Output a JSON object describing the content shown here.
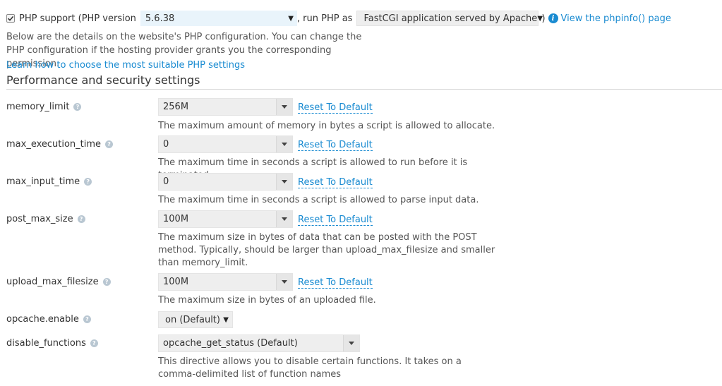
{
  "php_support": {
    "checked": true,
    "label": "PHP support (PHP version",
    "version_value": "5.6.38",
    "run_as_label": ", run PHP as",
    "handler_value": "FastCGI application served by Apache",
    "close_paren": ")",
    "phpinfo_link": "View the phpinfo() page"
  },
  "description": "Below are the details on the website's PHP configuration. You can change the PHP configuration if the hosting provider grants you the corresponding permission.",
  "learn_link": "Learn how to choose the most suitable PHP settings",
  "section_title": "Performance and security settings",
  "reset_label": "Reset To Default",
  "settings": [
    {
      "name": "memory_limit",
      "value": "256M",
      "help": "The maximum amount of memory in bytes a script is allowed to allocate."
    },
    {
      "name": "max_execution_time",
      "value": "0",
      "help": "The maximum time in seconds a script is allowed to run before it is terminated."
    },
    {
      "name": "max_input_time",
      "value": "0",
      "help": "The maximum time in seconds a script is allowed to parse input data."
    },
    {
      "name": "post_max_size",
      "value": "100M",
      "help": "The maximum size in bytes of data that can be posted with the POST method. Typically, should be larger than upload_max_filesize and smaller than memory_limit."
    },
    {
      "name": "upload_max_filesize",
      "value": "100M",
      "help": "The maximum size in bytes of an uploaded file."
    },
    {
      "name": "opcache.enable",
      "value": "on (Default)"
    },
    {
      "name": "disable_functions",
      "value": "opcache_get_status (Default)",
      "help": "This directive allows you to disable certain functions. It takes on a comma-delimited list of function names"
    }
  ],
  "colors": {
    "link": "#1a8bd1",
    "field_bg": "#eeeeee",
    "version_bg": "#e9f4fb"
  }
}
